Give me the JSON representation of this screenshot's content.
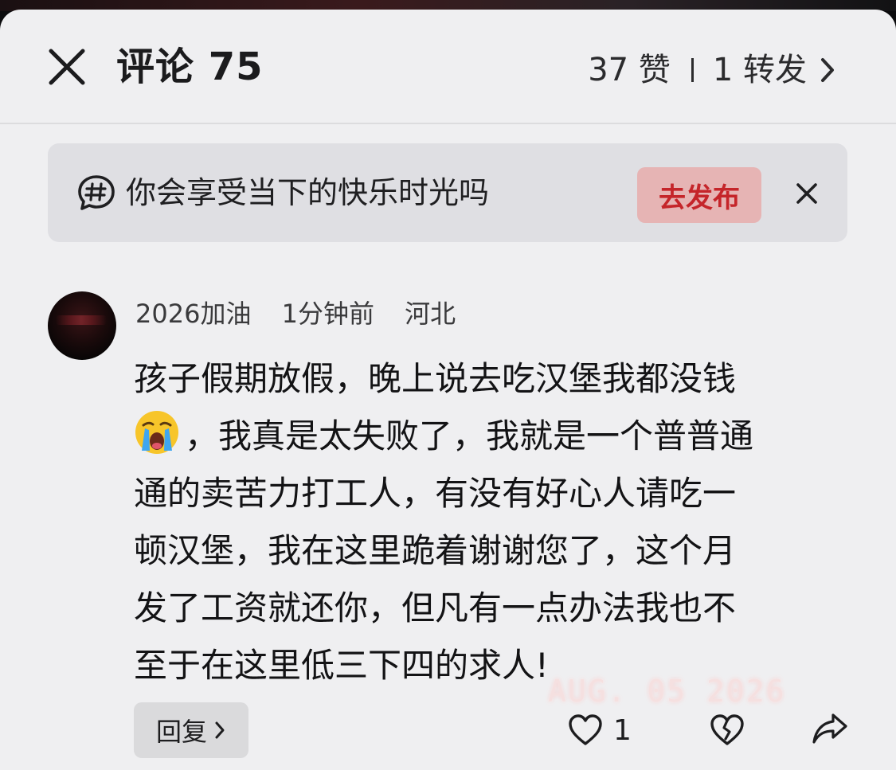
{
  "header": {
    "title": "评论 75",
    "likes": "37 赞",
    "reposts": "1 转发"
  },
  "topic_banner": {
    "text": "你会享受当下的快乐时光吗",
    "publish_label": "去发布"
  },
  "comment": {
    "username": "2026加油",
    "time": "1分钟前",
    "location": "河北",
    "lines": [
      "孩子假期放假，晚上说去吃汉堡我都没钱",
      "，我真是太失败了，我就是一个普普通",
      "通的卖苦力打工人，有没有好心人请吃一",
      "顿汉堡，我在这里跪着谢谢您了，这个月",
      "发了工资就还你，但凡有一点办法我也不",
      "至于在这里低三下四的求人!"
    ],
    "emoji": "loudly-crying-face",
    "reply_label": "回复",
    "like_count": "1"
  },
  "watermark": "AUG. 05 2026",
  "icons": {
    "close": "close-icon",
    "chevron": "chevron-right-icon",
    "topic": "hashtag-chat-icon",
    "like": "heart-icon",
    "dislike": "broken-heart-icon",
    "share": "share-icon"
  },
  "colors": {
    "background": "#efeff1",
    "banner": "#dfdfe3",
    "publish_bg": "#e6b4b4",
    "publish_text": "#c5252a",
    "text": "#131315"
  }
}
